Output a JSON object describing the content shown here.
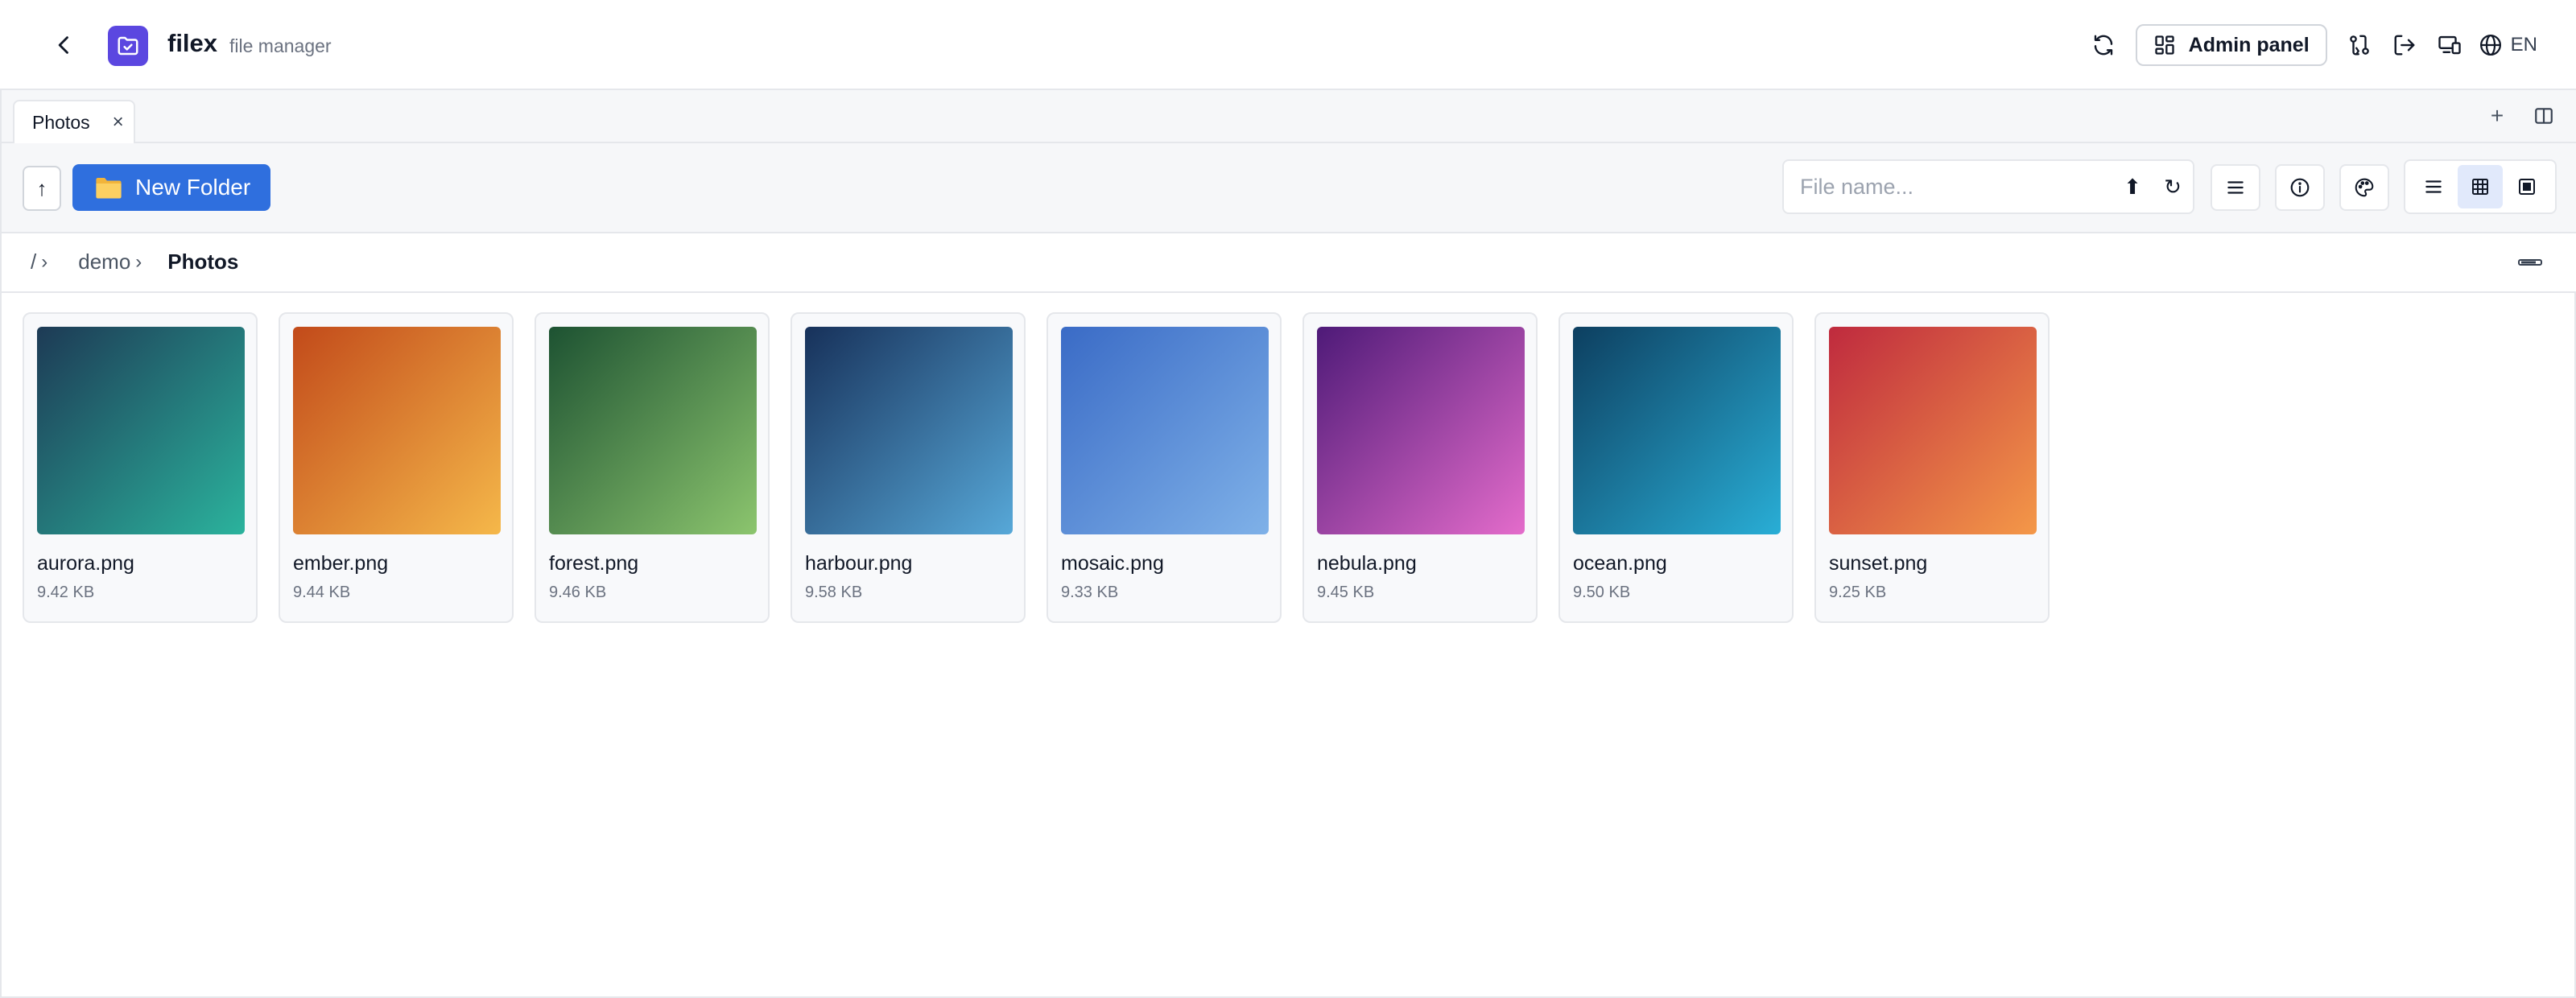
{
  "header": {
    "app_name": "filex",
    "app_subtitle": "file manager",
    "admin_label": "Admin panel",
    "language": "EN"
  },
  "tabs": [
    {
      "label": "Photos",
      "close": "×"
    }
  ],
  "tabbar": {
    "add_label": "+"
  },
  "toolbar": {
    "up_label": "↑",
    "new_folder_label": "New Folder",
    "search_placeholder": "File name...",
    "search_value": "",
    "sort_label": "⬆",
    "refresh_label": "↻"
  },
  "breadcrumb": {
    "root": "/",
    "items": [
      "demo",
      "Photos"
    ],
    "separator": "›"
  },
  "files": [
    {
      "name": "aurora.png",
      "size": "9.42 KB",
      "color_a": "#1d3a55",
      "color_b": "#2bb39d"
    },
    {
      "name": "ember.png",
      "size": "9.44 KB",
      "color_a": "#c24a1a",
      "color_b": "#f5b84a"
    },
    {
      "name": "forest.png",
      "size": "9.46 KB",
      "color_a": "#1d5232",
      "color_b": "#8cc56e"
    },
    {
      "name": "harbour.png",
      "size": "9.58 KB",
      "color_a": "#17315a",
      "color_b": "#57a8d8"
    },
    {
      "name": "mosaic.png",
      "size": "9.33 KB",
      "color_a": "#3a6bc6",
      "color_b": "#7fb1e8"
    },
    {
      "name": "nebula.png",
      "size": "9.45 KB",
      "color_a": "#4e1a78",
      "color_b": "#e46ccb"
    },
    {
      "name": "ocean.png",
      "size": "9.50 KB",
      "color_a": "#0d3f60",
      "color_b": "#29aed6"
    },
    {
      "name": "sunset.png",
      "size": "9.25 KB",
      "color_a": "#bf2a3e",
      "color_b": "#f49848"
    }
  ],
  "colors": {
    "accent": "#2f6fde",
    "brand": "#5b47e0",
    "active_view_bg": "#e1e9fb"
  }
}
